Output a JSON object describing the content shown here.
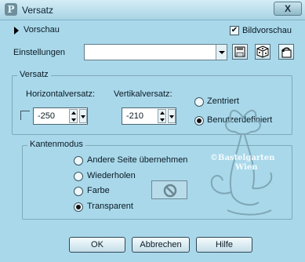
{
  "window": {
    "title": "Versatz",
    "close_symbol": "X"
  },
  "preview": {
    "toggle_label": "Vorschau",
    "show_preview_label": "Bildvorschau",
    "show_preview_checked": true
  },
  "settings": {
    "label": "Einstellungen",
    "value": ""
  },
  "offset": {
    "group_label": "Versatz",
    "horizontal_label": "Horizontalversatz:",
    "horizontal_value": "-250",
    "vertical_label": "Vertikalversatz:",
    "vertical_value": "-210",
    "link_checked": false,
    "centered_label": "Zentriert",
    "custom_label": "Benutzerdefiniert",
    "selected": "Benutzerdefiniert"
  },
  "edge_mode": {
    "group_label": "Kantenmodus",
    "options": [
      "Andere Seite übernehmen",
      "Wiederholen",
      "Farbe",
      "Transparent"
    ],
    "selected": "Transparent"
  },
  "watermark": {
    "line1": "©Bastelgarten",
    "line2": "Wien"
  },
  "buttons": {
    "ok": "OK",
    "cancel": "Abbrechen",
    "help": "Hilfe"
  },
  "icons": {
    "app": "paint-app-icon",
    "save": "save-icon",
    "random": "dice-icon",
    "reset": "reset-icon",
    "no_color": "no-color-icon"
  },
  "colors": {
    "dialog_background": "#a9d8ea",
    "title_bar": "#c6e6f1"
  }
}
